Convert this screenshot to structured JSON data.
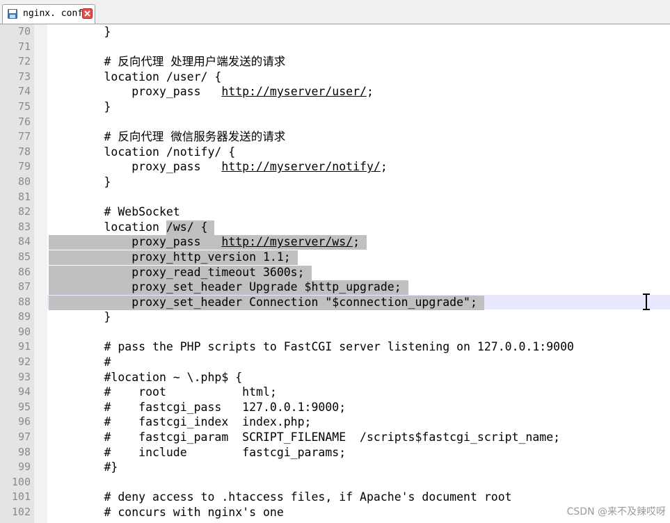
{
  "tab": {
    "title": "nginx. conf",
    "icon": "save-file-icon",
    "close_icon": "close-icon"
  },
  "lines": [
    {
      "n": "70",
      "pre": "        }",
      "sel": "",
      "post": ""
    },
    {
      "n": "71",
      "pre": "",
      "sel": "",
      "post": ""
    },
    {
      "n": "72",
      "pre": "        # 反向代理 处理用户端发送的请求",
      "sel": "",
      "post": ""
    },
    {
      "n": "73",
      "pre": "        location /user/ {",
      "sel": "",
      "post": ""
    },
    {
      "n": "74",
      "pre": "            proxy_pass   ",
      "url": "http://myserver/user/",
      "after": ";",
      "sel": "",
      "post": ""
    },
    {
      "n": "75",
      "pre": "        }",
      "sel": "",
      "post": ""
    },
    {
      "n": "76",
      "pre": "",
      "sel": "",
      "post": ""
    },
    {
      "n": "77",
      "pre": "        # 反向代理 微信服务器发送的请求",
      "sel": "",
      "post": ""
    },
    {
      "n": "78",
      "pre": "        location /notify/ {",
      "sel": "",
      "post": ""
    },
    {
      "n": "79",
      "pre": "            proxy_pass   ",
      "url": "http://myserver/notify/",
      "after": ";",
      "sel": "",
      "post": ""
    },
    {
      "n": "80",
      "pre": "        }",
      "sel": "",
      "post": ""
    },
    {
      "n": "81",
      "pre": "",
      "sel": "",
      "post": ""
    },
    {
      "n": "82",
      "pre": "        # WebSocket",
      "sel": "",
      "post": ""
    },
    {
      "n": "83",
      "pre": "        location ",
      "sel": "/ws/ { ",
      "post": ""
    },
    {
      "n": "84",
      "pre": "",
      "sel": "            proxy_pass   http://myserver/ws/; ",
      "post": ""
    },
    {
      "n": "85",
      "pre": "",
      "sel": "            proxy_http_version 1.1; ",
      "post": ""
    },
    {
      "n": "86",
      "pre": "",
      "sel": "            proxy_read_timeout 3600s; ",
      "post": ""
    },
    {
      "n": "87",
      "pre": "",
      "sel": "            proxy_set_header Upgrade $http_upgrade; ",
      "post": ""
    },
    {
      "n": "88",
      "pre": "",
      "sel": "            proxy_set_header Connection \"$connection_upgrade\"; ",
      "post": "",
      "current": true
    },
    {
      "n": "89",
      "pre": "        }",
      "sel": "",
      "post": ""
    },
    {
      "n": "90",
      "pre": "",
      "sel": "",
      "post": ""
    },
    {
      "n": "91",
      "pre": "        # pass the PHP scripts to FastCGI server listening on 127.0.0.1:9000",
      "sel": "",
      "post": ""
    },
    {
      "n": "92",
      "pre": "        #",
      "sel": "",
      "post": ""
    },
    {
      "n": "93",
      "pre": "        #location ~ \\.php$ {",
      "sel": "",
      "post": ""
    },
    {
      "n": "94",
      "pre": "        #    root           html;",
      "sel": "",
      "post": ""
    },
    {
      "n": "95",
      "pre": "        #    fastcgi_pass   127.0.0.1:9000;",
      "sel": "",
      "post": ""
    },
    {
      "n": "96",
      "pre": "        #    fastcgi_index  index.php;",
      "sel": "",
      "post": ""
    },
    {
      "n": "97",
      "pre": "        #    fastcgi_param  SCRIPT_FILENAME  /scripts$fastcgi_script_name;",
      "sel": "",
      "post": ""
    },
    {
      "n": "98",
      "pre": "        #    include        fastcgi_params;",
      "sel": "",
      "post": ""
    },
    {
      "n": "99",
      "pre": "        #}",
      "sel": "",
      "post": ""
    },
    {
      "n": "100",
      "pre": "",
      "sel": "",
      "post": ""
    },
    {
      "n": "101",
      "pre": "        # deny access to .htaccess files, if Apache's document root",
      "sel": "",
      "post": ""
    },
    {
      "n": "102",
      "pre": "        # concurs with nginx's one",
      "sel": "",
      "post": ""
    }
  ],
  "watermark": "CSDN @来不及辣哎呀",
  "colors": {
    "selection": "#c0c0c0",
    "current_line": "#e8e8ff",
    "gutter": "#e4e4e4"
  }
}
